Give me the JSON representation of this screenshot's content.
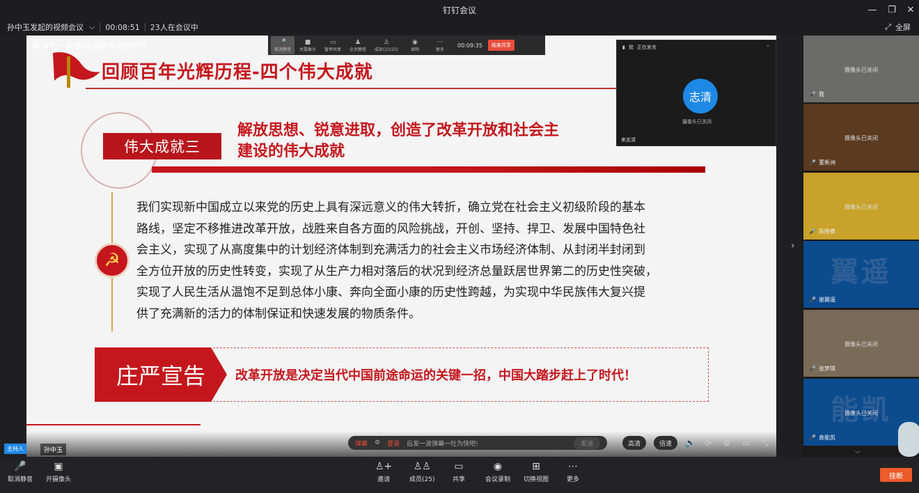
{
  "window": {
    "title": "钉钉会议",
    "minimize": "—",
    "maximize": "❐",
    "close": "✕"
  },
  "meeting": {
    "name": "孙中玉发起的视频会议",
    "dropdown": "⌵",
    "duration": "00:08:51",
    "participants": "23人在会议中",
    "fullscreen": "全屏"
  },
  "share": {
    "title": "解读七一重要讲话精神讲稿PPT",
    "toolbar": [
      {
        "icon": "mic-icon",
        "glyph": "🎤",
        "label": "取消静音"
      },
      {
        "icon": "camera-icon",
        "glyph": "■",
        "label": "关摄像头"
      },
      {
        "icon": "share-icon",
        "glyph": "▭",
        "label": "暂停共享"
      },
      {
        "icon": "mute-all-icon",
        "glyph": "♟",
        "label": "全员静音"
      },
      {
        "icon": "members-icon",
        "glyph": "♙",
        "label": "成员(23/25)"
      },
      {
        "icon": "record-icon",
        "glyph": "◉",
        "label": "录制"
      },
      {
        "icon": "more-icon",
        "glyph": "⋯",
        "label": "更多"
      }
    ],
    "timer": "00:09:35",
    "end_share": "结束共享"
  },
  "speaker": {
    "header": "正在发言",
    "me": "我",
    "avatar": "志清",
    "camera": "摄像头已关闭",
    "name": "来志清"
  },
  "slide": {
    "title": "回顾百年光辉历程-四个伟大成就",
    "achievement_label": "伟大成就三",
    "achievement_text": "解放思想、锐意进取，创造了改革开放和社会主义现代化建设的伟大成就",
    "achievement_line1": "解放思想、锐意进取，创造了改革开放和社会主",
    "achievement_line2": "建设的伟大成就",
    "body_lines": [
      "我们实现新中国成立以来党的历史上具有深远意义的伟大转折，确立党在社会主义初级阶段的基本",
      "路线，坚定不移推进改革开放，战胜来自各方面的风险挑战，开创、坚持、捍卫、发展中国特色社",
      "会主义，实现了从高度集中的计划经济体制到充满活力的社会主义市场经济体制、从封闭半封闭到",
      "全方位开放的历史性转变，实现了从生产力相对落后的状况到经济总量跃居世界第二的历史性突破，",
      "实现了人民生活从温饱不足到总体小康、奔向全面小康的历史性跨越，为实现中华民族伟大复兴提",
      "供了充满新的活力的体制保证和快速发展的物质条件。"
    ],
    "declaration_label": "庄严宣告",
    "declaration_text": "改革开放是决定当代中国前途命运的关键一招，中国大踏步赶上了时代！",
    "party_emblem": "☭"
  },
  "player": {
    "danmaku_label": "弹幕",
    "danmaku_placeholder": "后发一波弹幕一吐为快吧!",
    "login": "登录",
    "send": "发送",
    "quality": "高清",
    "speed": "倍速"
  },
  "host": {
    "badge": "主持人",
    "name": "孙中玉"
  },
  "participants": [
    {
      "name": "我",
      "camera": "摄像头已关闭",
      "bg": "#6b6b68",
      "big": ""
    },
    {
      "name": "董新洲",
      "camera": "摄像头已关闭",
      "bg": "#5a3a20",
      "big": ""
    },
    {
      "name": "陈晓睿",
      "camera": "摄像头已关闭",
      "bg": "#c8a22a",
      "big": ""
    },
    {
      "name": "谢翼遥",
      "camera": "",
      "bg": "#0b4c8f",
      "big": "翼遥"
    },
    {
      "name": "张梦琪",
      "camera": "摄像头已关闭",
      "bg": "#7a6a58",
      "big": ""
    },
    {
      "name": "袁能凯",
      "camera": "摄像头已关闭",
      "bg": "#0b4c8f",
      "big": "能凯"
    }
  ],
  "bottombar": {
    "unmute": "取消静音",
    "camera": "开摄像头",
    "invite": "邀请",
    "members": "成员(25)",
    "share": "共享",
    "record": "会议录制",
    "switch_view": "切换视图",
    "more": "更多",
    "hangup": "挂断"
  },
  "colors": {
    "accent_red": "#c5161d",
    "hangup": "#ec5b2a",
    "speaker_avatar": "#1e88e5"
  }
}
